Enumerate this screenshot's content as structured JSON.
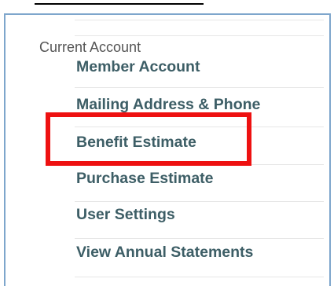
{
  "sidebar": {
    "section_heading": "Current Account",
    "items": [
      {
        "label": "Member Account"
      },
      {
        "label": "Mailing Address & Phone"
      },
      {
        "label": "Benefit Estimate"
      },
      {
        "label": "Purchase Estimate"
      },
      {
        "label": "User Settings"
      },
      {
        "label": "View Annual Statements"
      }
    ]
  },
  "annotation": {
    "highlight_color": "#ee1111"
  },
  "colors": {
    "link": "#3d5e66",
    "heading": "#555555",
    "panel_border": "#7ea6cc"
  }
}
